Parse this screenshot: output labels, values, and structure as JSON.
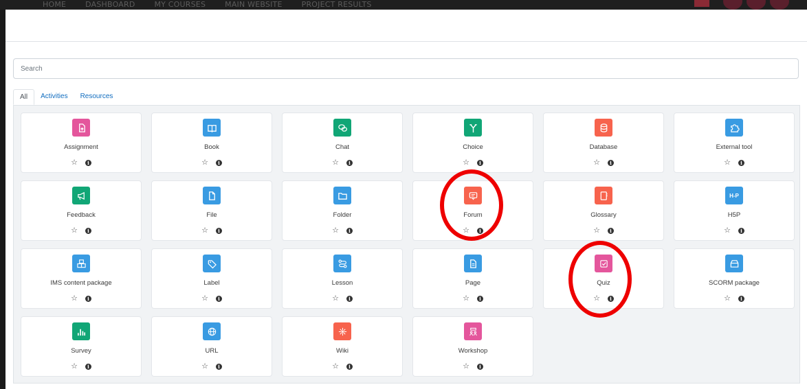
{
  "background_nav": {
    "items": [
      "HOME",
      "DASHBOARD",
      "MY COURSES",
      "MAIN WEBSITE",
      "PROJECT RESULTS"
    ]
  },
  "search": {
    "placeholder": "Search",
    "value": ""
  },
  "tabs": [
    {
      "label": "All",
      "active": true
    },
    {
      "label": "Activities",
      "active": false
    },
    {
      "label": "Resources",
      "active": false
    }
  ],
  "modules": [
    {
      "name": "Assignment",
      "icon": "assignment-icon",
      "color": "#e4569c"
    },
    {
      "name": "Book",
      "icon": "book-icon",
      "color": "#399be2"
    },
    {
      "name": "Chat",
      "icon": "chat-icon",
      "color": "#11a676"
    },
    {
      "name": "Choice",
      "icon": "choice-icon",
      "color": "#11a676"
    },
    {
      "name": "Database",
      "icon": "database-icon",
      "color": "#f7634d"
    },
    {
      "name": "External tool",
      "icon": "puzzle-icon",
      "color": "#399be2"
    },
    {
      "name": "Feedback",
      "icon": "megaphone-icon",
      "color": "#11a676"
    },
    {
      "name": "File",
      "icon": "file-icon",
      "color": "#399be2"
    },
    {
      "name": "Folder",
      "icon": "folder-icon",
      "color": "#399be2"
    },
    {
      "name": "Forum",
      "icon": "forum-icon",
      "color": "#f7634d"
    },
    {
      "name": "Glossary",
      "icon": "glossary-icon",
      "color": "#f7634d"
    },
    {
      "name": "H5P",
      "icon": "h5p-icon",
      "color": "#399be2",
      "glyph": "H-P"
    },
    {
      "name": "IMS content package",
      "icon": "package-icon",
      "color": "#399be2"
    },
    {
      "name": "Label",
      "icon": "tag-icon",
      "color": "#399be2"
    },
    {
      "name": "Lesson",
      "icon": "lesson-icon",
      "color": "#399be2"
    },
    {
      "name": "Page",
      "icon": "page-icon",
      "color": "#399be2"
    },
    {
      "name": "Quiz",
      "icon": "quiz-icon",
      "color": "#e4569c"
    },
    {
      "name": "SCORM package",
      "icon": "scorm-icon",
      "color": "#399be2"
    },
    {
      "name": "Survey",
      "icon": "survey-icon",
      "color": "#11a676"
    },
    {
      "name": "URL",
      "icon": "globe-icon",
      "color": "#399be2"
    },
    {
      "name": "Wiki",
      "icon": "wiki-icon",
      "color": "#f7634d"
    },
    {
      "name": "Workshop",
      "icon": "workshop-icon",
      "color": "#e4569c"
    }
  ],
  "annotations": [
    {
      "target": "Forum",
      "color": "#ee0000"
    },
    {
      "target": "Quiz",
      "color": "#ee0000"
    }
  ]
}
